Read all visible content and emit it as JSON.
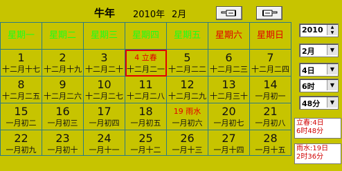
{
  "header": {
    "animal_year": "牛年",
    "year_label": "2010年",
    "month_label": "2月",
    "prev_button_icon": "pointing-hand-left-icon",
    "next_button_icon": "pointing-hand-right-icon"
  },
  "colors": {
    "background": "#c7c400",
    "weekday_label": "#1aff1a",
    "weekend_label": "#e00000",
    "term_text": "#e00000",
    "grid_line": "#2a7a86"
  },
  "weekdays": [
    "星期一",
    "星期二",
    "星期三",
    "星期四",
    "星期五",
    "星期六",
    "星期日"
  ],
  "weeks": [
    [
      {
        "day": "1",
        "lunar": "十二月十七"
      },
      {
        "day": "2",
        "lunar": "十二月十九"
      },
      {
        "day": "3",
        "lunar": "十二月二十"
      },
      {
        "day": "4",
        "lunar": "十二月二一",
        "term": "立春",
        "selected": true
      },
      {
        "day": "5",
        "lunar": "十二月二二"
      },
      {
        "day": "6",
        "lunar": "十二月二三"
      },
      {
        "day": "7",
        "lunar": "十二月二四"
      }
    ],
    [
      {
        "day": "8",
        "lunar": "十二月二五"
      },
      {
        "day": "9",
        "lunar": "十二月二六"
      },
      {
        "day": "10",
        "lunar": "十二月二七"
      },
      {
        "day": "11",
        "lunar": "十二月二八"
      },
      {
        "day": "12",
        "lunar": "十二月二九"
      },
      {
        "day": "13",
        "lunar": "十二月三十"
      },
      {
        "day": "14",
        "lunar": "一月初一"
      }
    ],
    [
      {
        "day": "15",
        "lunar": "一月初二"
      },
      {
        "day": "16",
        "lunar": "一月初三"
      },
      {
        "day": "17",
        "lunar": "一月初四"
      },
      {
        "day": "18",
        "lunar": "一月初五"
      },
      {
        "day": "19",
        "lunar": "一月初六",
        "term": "雨水"
      },
      {
        "day": "20",
        "lunar": "一月初七"
      },
      {
        "day": "21",
        "lunar": "一月初八"
      }
    ],
    [
      {
        "day": "22",
        "lunar": "一月初九"
      },
      {
        "day": "23",
        "lunar": "一月初十"
      },
      {
        "day": "24",
        "lunar": "一月十一"
      },
      {
        "day": "25",
        "lunar": "一月十二"
      },
      {
        "day": "26",
        "lunar": "一月十三"
      },
      {
        "day": "27",
        "lunar": "一月十四"
      },
      {
        "day": "28",
        "lunar": "一月十五"
      }
    ]
  ],
  "side": {
    "year_value": "2010",
    "month_value": "2月",
    "day_value": "4日",
    "hour_value": "6时",
    "minute_value": "48分",
    "term_info_1": "立春:4日\n6时48分",
    "term_info_2": "雨水:19日\n2时36分"
  }
}
